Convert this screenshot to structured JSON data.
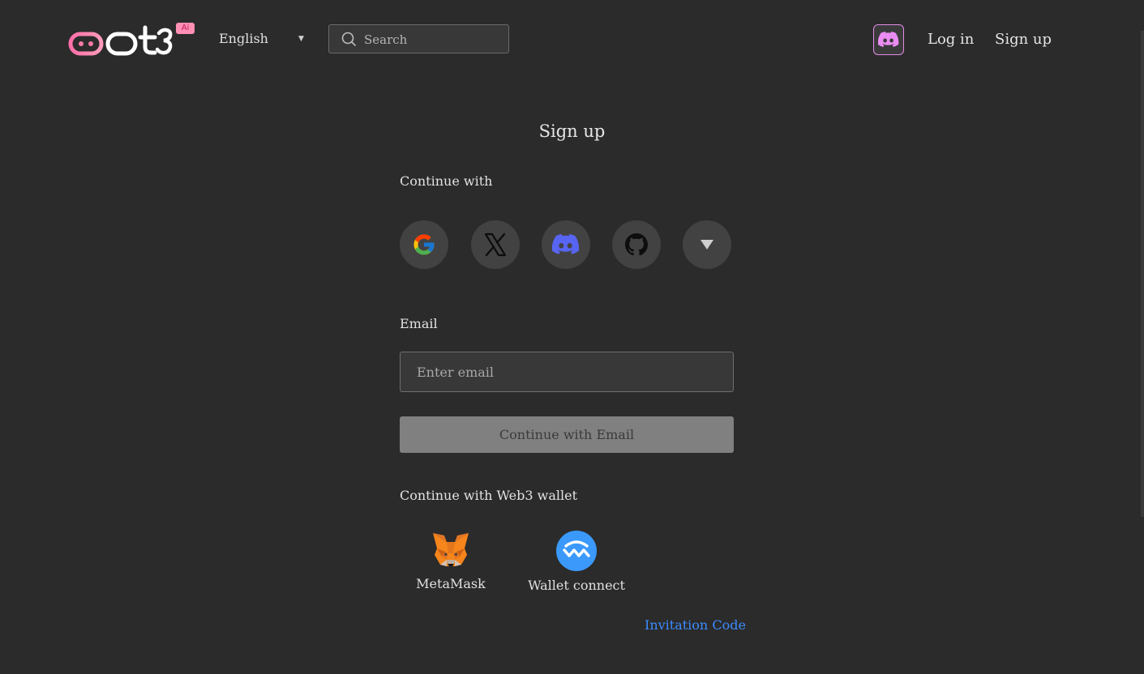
{
  "header": {
    "logo_text": "bot3",
    "logo_badge": "Ai",
    "language": "English",
    "search_placeholder": "Search",
    "login_label": "Log in",
    "signup_label": "Sign up"
  },
  "signup": {
    "title": "Sign up",
    "continue_with_label": "Continue with",
    "social_providers": [
      "google",
      "x",
      "discord",
      "github",
      "more"
    ],
    "email_label": "Email",
    "email_placeholder": "Enter email",
    "email_value": "",
    "continue_email_button": "Continue with Email",
    "web3_label": "Continue with Web3 wallet",
    "wallets": [
      {
        "name": "MetaMask",
        "icon": "metamask-fox-icon"
      },
      {
        "name": "Wallet connect",
        "icon": "walletconnect-icon"
      }
    ],
    "invitation_link": "Invitation Code"
  },
  "colors": {
    "background": "#2b2b2b",
    "brand_pink": "#ff7aa8",
    "link_blue": "#3b8cff",
    "discord_blurple": "#5865f2",
    "button_disabled": "#808080"
  }
}
